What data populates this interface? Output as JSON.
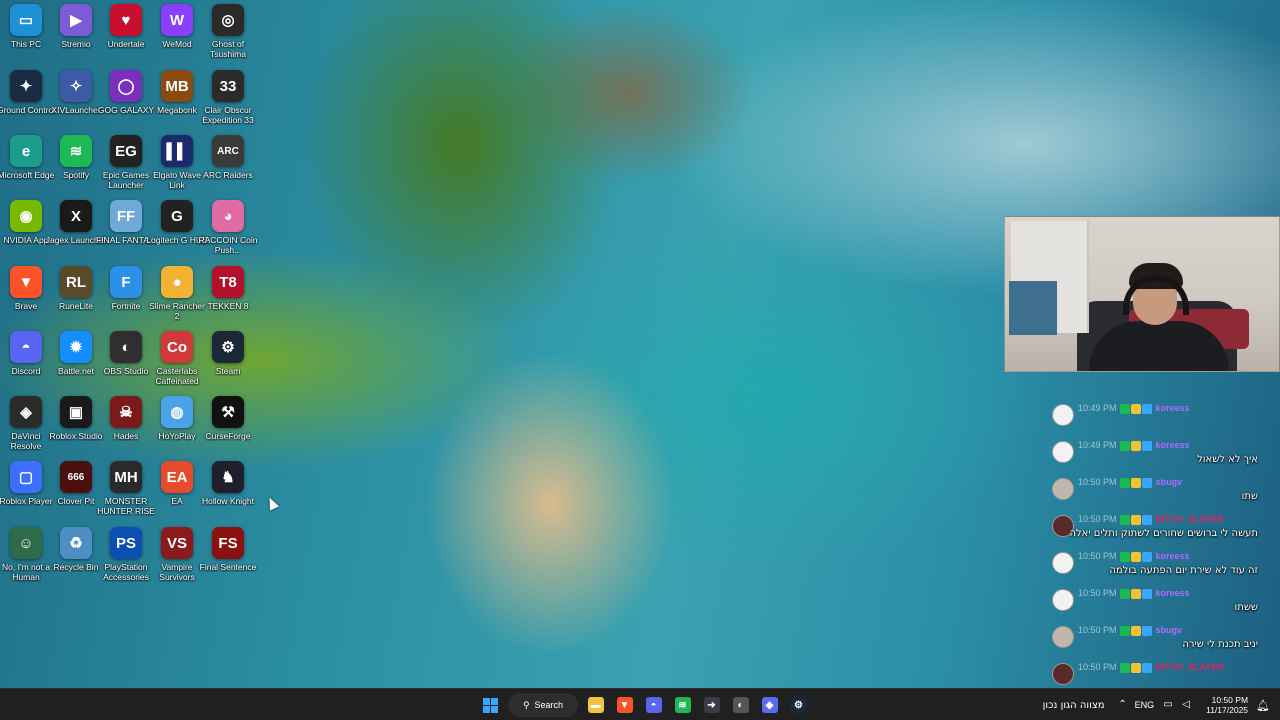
{
  "desktop": {
    "icons": [
      {
        "label": "This PC",
        "glyph": "▭",
        "color": "#1e90d6"
      },
      {
        "label": "Stremio",
        "glyph": "▶",
        "color": "#7b5bd6"
      },
      {
        "label": "Undertale",
        "glyph": "♥",
        "color": "#c8102e"
      },
      {
        "label": "WeMod",
        "glyph": "W",
        "color": "#8a3ffc"
      },
      {
        "label": "Ghost of Tsushima",
        "glyph": "◎",
        "color": "#2a2a2a"
      },
      {
        "label": "Ground Control",
        "glyph": "✦",
        "color": "#1a2b44"
      },
      {
        "label": "XIVLauncher",
        "glyph": "✧",
        "color": "#3c5aa6"
      },
      {
        "label": "GOG GALAXY",
        "glyph": "◯",
        "color": "#7a2fbf"
      },
      {
        "label": "Megabonk",
        "glyph": "MB",
        "color": "#8b4a12"
      },
      {
        "label": "Clair Obscur Expedition 33",
        "glyph": "33",
        "color": "#2b2b2b"
      },
      {
        "label": "Microsoft Edge",
        "glyph": "e",
        "color": "#1c9c8c"
      },
      {
        "label": "Spotify",
        "glyph": "≋",
        "color": "#1db954"
      },
      {
        "label": "Epic Games Launcher",
        "glyph": "EG",
        "color": "#222222"
      },
      {
        "label": "Elgato Wave Link",
        "glyph": "▌▌",
        "color": "#1b2a6b"
      },
      {
        "label": "ARC Raiders",
        "glyph": "ARC",
        "color": "#3a3a3a"
      },
      {
        "label": "NVIDIA App",
        "glyph": "◉",
        "color": "#76b900"
      },
      {
        "label": "Jagex Launcher",
        "glyph": "X",
        "color": "#1a1a1a"
      },
      {
        "label": "FINAL FANTA...",
        "glyph": "FF",
        "color": "#6fa9d9"
      },
      {
        "label": "Logitech G HUB",
        "glyph": "G",
        "color": "#222222"
      },
      {
        "label": "RACCOIN Coin Push...",
        "glyph": "◕",
        "color": "#e06aa3"
      },
      {
        "label": "Brave",
        "glyph": "▼",
        "color": "#fb542b"
      },
      {
        "label": "RuneLite",
        "glyph": "RL",
        "color": "#5a4a2a"
      },
      {
        "label": "Fortnite",
        "glyph": "F",
        "color": "#2e8fe6"
      },
      {
        "label": "Slime Rancher 2",
        "glyph": "●",
        "color": "#f2b233"
      },
      {
        "label": "TEKKEN 8",
        "glyph": "T8",
        "color": "#b3102a"
      },
      {
        "label": "Discord",
        "glyph": "◓",
        "color": "#5865f2"
      },
      {
        "label": "Battle.net",
        "glyph": "✹",
        "color": "#148eff"
      },
      {
        "label": "OBS Studio",
        "glyph": "◐",
        "color": "#302e31"
      },
      {
        "label": "Casterlabs Caffeinated",
        "glyph": "Co",
        "color": "#d13a3a"
      },
      {
        "label": "Steam",
        "glyph": "⚙",
        "color": "#1b2838"
      },
      {
        "label": "DaVinci Resolve",
        "glyph": "◈",
        "color": "#2b2b2b"
      },
      {
        "label": "Roblox Studio",
        "glyph": "▣",
        "color": "#1a1a1a"
      },
      {
        "label": "Hades",
        "glyph": "☠",
        "color": "#7a1b1b"
      },
      {
        "label": "HoYoPlay",
        "glyph": "◍",
        "color": "#4aa3e8"
      },
      {
        "label": "CurseForge",
        "glyph": "⚒",
        "color": "#111111"
      },
      {
        "label": "Roblox Player",
        "glyph": "▢",
        "color": "#3d6fff"
      },
      {
        "label": "Clover Pit",
        "glyph": "666",
        "color": "#4b0f0f"
      },
      {
        "label": "MONSTER HUNTER RISE",
        "glyph": "MH",
        "color": "#2a2a2a"
      },
      {
        "label": "EA",
        "glyph": "EA",
        "color": "#e84a2c"
      },
      {
        "label": "Hollow Knight",
        "glyph": "♞",
        "color": "#1f1f2e"
      },
      {
        "label": "No, I'm not a Human",
        "glyph": "☺",
        "color": "#2e6b4a"
      },
      {
        "label": "Recycle Bin",
        "glyph": "♻",
        "color": "#4d8fc4"
      },
      {
        "label": "PlayStation Accessories",
        "glyph": "PS",
        "color": "#0b4fb3"
      },
      {
        "label": "Vampire Survivors",
        "glyph": "VS",
        "color": "#8b1a1a"
      },
      {
        "label": "Final Sentence",
        "glyph": "FS",
        "color": "#8b1010"
      }
    ]
  },
  "chat": {
    "messages": [
      {
        "time": "10:49 PM",
        "user": "koreess",
        "user_color": "#b06bff",
        "text": "",
        "avatar": "light"
      },
      {
        "time": "10:49 PM",
        "user": "koreess",
        "user_color": "#b06bff",
        "text": "איך לא לשאול",
        "avatar": "light"
      },
      {
        "time": "10:50 PM",
        "user": "sbugv",
        "user_color": "#b06bff",
        "text": "שתו",
        "avatar": "face"
      },
      {
        "time": "10:50 PM",
        "user": "BITCH_SLAYER",
        "user_color": "#e0245e",
        "text": "תעשה לי ברושים שחורים לשתוק ותלים יאלה",
        "avatar": "dark"
      },
      {
        "time": "10:50 PM",
        "user": "koreess",
        "user_color": "#b06bff",
        "text": "זה עוד לא שירת יום הפתעה בולמה",
        "avatar": "light"
      },
      {
        "time": "10:50 PM",
        "user": "koreess",
        "user_color": "#b06bff",
        "text": "ששתו",
        "avatar": "light"
      },
      {
        "time": "10:50 PM",
        "user": "sbugv",
        "user_color": "#b06bff",
        "text": "יניב תכנת לי שירה",
        "avatar": "face"
      },
      {
        "time": "10:50 PM",
        "user": "BITCH_SLAYER",
        "user_color": "#e0245e",
        "text": "",
        "avatar": "dark"
      }
    ]
  },
  "taskbar": {
    "search_label": "Search",
    "pinned": [
      {
        "name": "file-explorer",
        "glyph": "▬",
        "color": "#f3c33d"
      },
      {
        "name": "brave",
        "glyph": "▼",
        "color": "#fb542b"
      },
      {
        "name": "discord",
        "glyph": "◓",
        "color": "#5865f2"
      },
      {
        "name": "spotify",
        "glyph": "≋",
        "color": "#1db954"
      },
      {
        "name": "tidal",
        "glyph": "➜",
        "color": "#3a3a4a"
      },
      {
        "name": "obs",
        "glyph": "◐",
        "color": "#555555"
      },
      {
        "name": "app-diamond",
        "glyph": "◆",
        "color": "#5a6cf0"
      },
      {
        "name": "steam",
        "glyph": "⚙",
        "color": "#1b2838"
      }
    ],
    "weather": "מצווה הגון נכון",
    "language": "ENG",
    "time": "10:50 PM",
    "date": "11/17/2025"
  }
}
